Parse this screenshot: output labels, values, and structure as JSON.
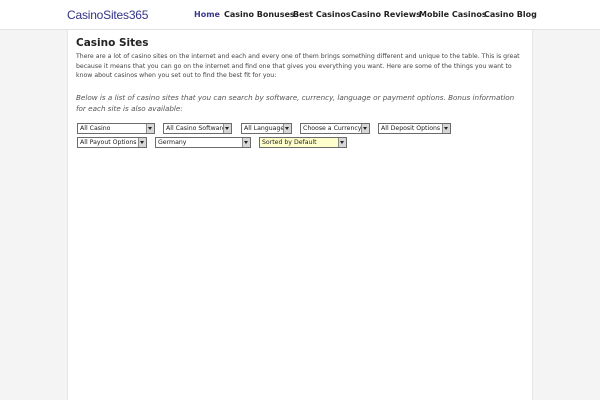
{
  "site": {
    "logo": "CasinoSites365"
  },
  "nav": {
    "items": [
      {
        "label": "Home",
        "active": true
      },
      {
        "label": "Casino Bonuses"
      },
      {
        "label": "Best Casinos"
      },
      {
        "label": "Casino Reviews"
      },
      {
        "label": "Mobile Casinos"
      },
      {
        "label": "Casino Blog"
      }
    ]
  },
  "main": {
    "title": "Casino Sites",
    "intro": "There are a lot of casino sites on the internet and each and every one of them brings something different and unique to the table. This is great because it means that you can go on the internet and find one that gives you everything you want. Here are some of the things you want to know about casinos when you set out to find the best fit for you:",
    "note": "Below is a list of casino sites that you can search by software, currency, language or payment options. Bonus information for each site is also available:"
  },
  "filters": {
    "type": "All Casino",
    "software": "All Casino Software",
    "language": "All Language",
    "currency": "Choose a Currency",
    "deposit": "All Deposit Options",
    "payout": "All Payout Options",
    "country": "Germany",
    "sort": "Sorted by Default"
  },
  "colors": {
    "logo": "#333388",
    "nav_active": "#3a3a8c",
    "sort_highlight": "#ffffcc"
  }
}
